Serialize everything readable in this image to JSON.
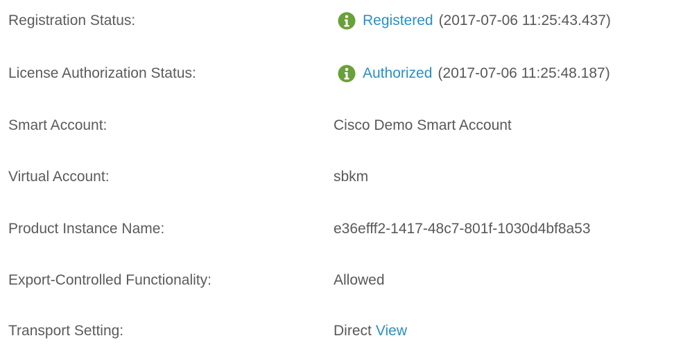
{
  "colors": {
    "label_text": "#5b5b5e",
    "value_text": "#58585b",
    "link": "#2a8fc4",
    "status_icon_green": "#6aa03a"
  },
  "rows": {
    "registration": {
      "label": "Registration Status:",
      "icon": "info-icon",
      "status": "Registered",
      "timestamp": "(2017-07-06 11:25:43.437)"
    },
    "license": {
      "label": "License Authorization Status:",
      "icon": "info-icon",
      "status": "Authorized",
      "timestamp": "(2017-07-06 11:25:48.187)"
    },
    "smart_account": {
      "label": "Smart Account:",
      "value": "Cisco Demo Smart Account"
    },
    "virtual_account": {
      "label": "Virtual Account:",
      "value": "sbkm"
    },
    "product_instance": {
      "label": "Product Instance Name:",
      "value": "e36efff2-1417-48c7-801f-1030d4bf8a53"
    },
    "export_controlled": {
      "label": "Export-Controlled Functionality:",
      "value": "Allowed"
    },
    "transport": {
      "label": "Transport Setting:",
      "value": "Direct",
      "link": "View"
    }
  }
}
